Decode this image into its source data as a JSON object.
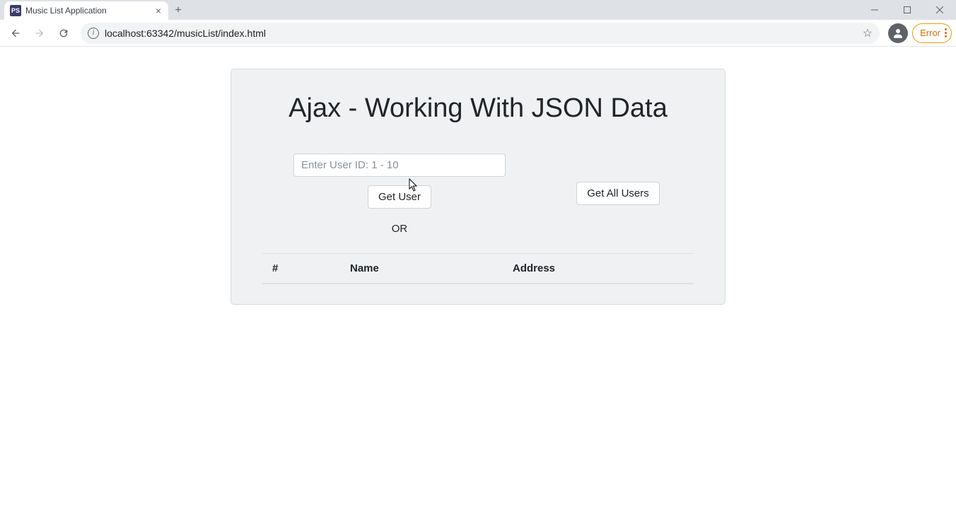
{
  "browser": {
    "tab_title": "Music List Application",
    "url": "localhost:63342/musicList/index.html",
    "error_label": "Error"
  },
  "page": {
    "heading": "Ajax - Working With JSON Data",
    "user_id_placeholder": "Enter User ID: 1 - 10",
    "get_user_label": "Get User",
    "get_all_users_label": "Get All Users",
    "or_label": "OR",
    "table_headers": {
      "index": "#",
      "name": "Name",
      "address": "Address"
    }
  }
}
